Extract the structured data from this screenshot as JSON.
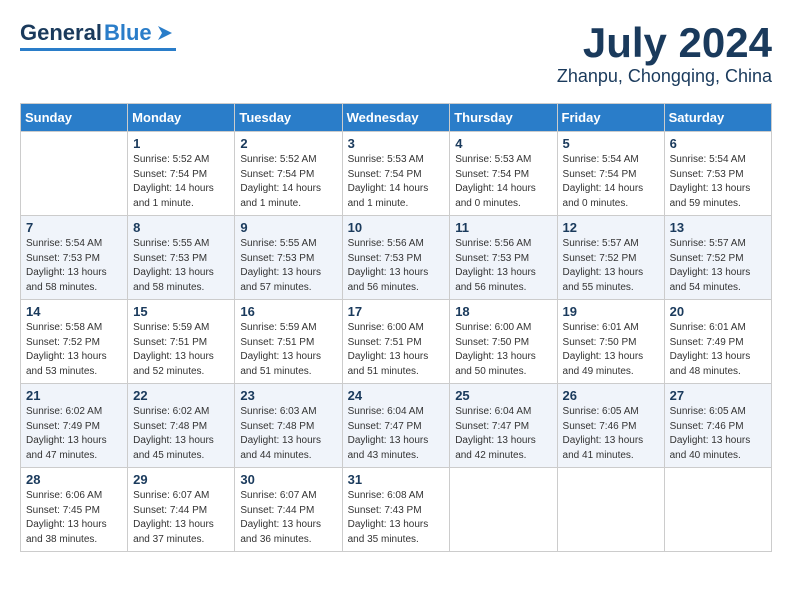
{
  "header": {
    "logo_general": "General",
    "logo_blue": "Blue",
    "month_title": "July 2024",
    "location": "Zhanpu, Chongqing, China"
  },
  "columns": [
    "Sunday",
    "Monday",
    "Tuesday",
    "Wednesday",
    "Thursday",
    "Friday",
    "Saturday"
  ],
  "weeks": [
    [
      {
        "day": "",
        "info": ""
      },
      {
        "day": "1",
        "info": "Sunrise: 5:52 AM\nSunset: 7:54 PM\nDaylight: 14 hours\nand 1 minute."
      },
      {
        "day": "2",
        "info": "Sunrise: 5:52 AM\nSunset: 7:54 PM\nDaylight: 14 hours\nand 1 minute."
      },
      {
        "day": "3",
        "info": "Sunrise: 5:53 AM\nSunset: 7:54 PM\nDaylight: 14 hours\nand 1 minute."
      },
      {
        "day": "4",
        "info": "Sunrise: 5:53 AM\nSunset: 7:54 PM\nDaylight: 14 hours\nand 0 minutes."
      },
      {
        "day": "5",
        "info": "Sunrise: 5:54 AM\nSunset: 7:54 PM\nDaylight: 14 hours\nand 0 minutes."
      },
      {
        "day": "6",
        "info": "Sunrise: 5:54 AM\nSunset: 7:53 PM\nDaylight: 13 hours\nand 59 minutes."
      }
    ],
    [
      {
        "day": "7",
        "info": "Sunrise: 5:54 AM\nSunset: 7:53 PM\nDaylight: 13 hours\nand 58 minutes."
      },
      {
        "day": "8",
        "info": "Sunrise: 5:55 AM\nSunset: 7:53 PM\nDaylight: 13 hours\nand 58 minutes."
      },
      {
        "day": "9",
        "info": "Sunrise: 5:55 AM\nSunset: 7:53 PM\nDaylight: 13 hours\nand 57 minutes."
      },
      {
        "day": "10",
        "info": "Sunrise: 5:56 AM\nSunset: 7:53 PM\nDaylight: 13 hours\nand 56 minutes."
      },
      {
        "day": "11",
        "info": "Sunrise: 5:56 AM\nSunset: 7:53 PM\nDaylight: 13 hours\nand 56 minutes."
      },
      {
        "day": "12",
        "info": "Sunrise: 5:57 AM\nSunset: 7:52 PM\nDaylight: 13 hours\nand 55 minutes."
      },
      {
        "day": "13",
        "info": "Sunrise: 5:57 AM\nSunset: 7:52 PM\nDaylight: 13 hours\nand 54 minutes."
      }
    ],
    [
      {
        "day": "14",
        "info": "Sunrise: 5:58 AM\nSunset: 7:52 PM\nDaylight: 13 hours\nand 53 minutes."
      },
      {
        "day": "15",
        "info": "Sunrise: 5:59 AM\nSunset: 7:51 PM\nDaylight: 13 hours\nand 52 minutes."
      },
      {
        "day": "16",
        "info": "Sunrise: 5:59 AM\nSunset: 7:51 PM\nDaylight: 13 hours\nand 51 minutes."
      },
      {
        "day": "17",
        "info": "Sunrise: 6:00 AM\nSunset: 7:51 PM\nDaylight: 13 hours\nand 51 minutes."
      },
      {
        "day": "18",
        "info": "Sunrise: 6:00 AM\nSunset: 7:50 PM\nDaylight: 13 hours\nand 50 minutes."
      },
      {
        "day": "19",
        "info": "Sunrise: 6:01 AM\nSunset: 7:50 PM\nDaylight: 13 hours\nand 49 minutes."
      },
      {
        "day": "20",
        "info": "Sunrise: 6:01 AM\nSunset: 7:49 PM\nDaylight: 13 hours\nand 48 minutes."
      }
    ],
    [
      {
        "day": "21",
        "info": "Sunrise: 6:02 AM\nSunset: 7:49 PM\nDaylight: 13 hours\nand 47 minutes."
      },
      {
        "day": "22",
        "info": "Sunrise: 6:02 AM\nSunset: 7:48 PM\nDaylight: 13 hours\nand 45 minutes."
      },
      {
        "day": "23",
        "info": "Sunrise: 6:03 AM\nSunset: 7:48 PM\nDaylight: 13 hours\nand 44 minutes."
      },
      {
        "day": "24",
        "info": "Sunrise: 6:04 AM\nSunset: 7:47 PM\nDaylight: 13 hours\nand 43 minutes."
      },
      {
        "day": "25",
        "info": "Sunrise: 6:04 AM\nSunset: 7:47 PM\nDaylight: 13 hours\nand 42 minutes."
      },
      {
        "day": "26",
        "info": "Sunrise: 6:05 AM\nSunset: 7:46 PM\nDaylight: 13 hours\nand 41 minutes."
      },
      {
        "day": "27",
        "info": "Sunrise: 6:05 AM\nSunset: 7:46 PM\nDaylight: 13 hours\nand 40 minutes."
      }
    ],
    [
      {
        "day": "28",
        "info": "Sunrise: 6:06 AM\nSunset: 7:45 PM\nDaylight: 13 hours\nand 38 minutes."
      },
      {
        "day": "29",
        "info": "Sunrise: 6:07 AM\nSunset: 7:44 PM\nDaylight: 13 hours\nand 37 minutes."
      },
      {
        "day": "30",
        "info": "Sunrise: 6:07 AM\nSunset: 7:44 PM\nDaylight: 13 hours\nand 36 minutes."
      },
      {
        "day": "31",
        "info": "Sunrise: 6:08 AM\nSunset: 7:43 PM\nDaylight: 13 hours\nand 35 minutes."
      },
      {
        "day": "",
        "info": ""
      },
      {
        "day": "",
        "info": ""
      },
      {
        "day": "",
        "info": ""
      }
    ]
  ]
}
